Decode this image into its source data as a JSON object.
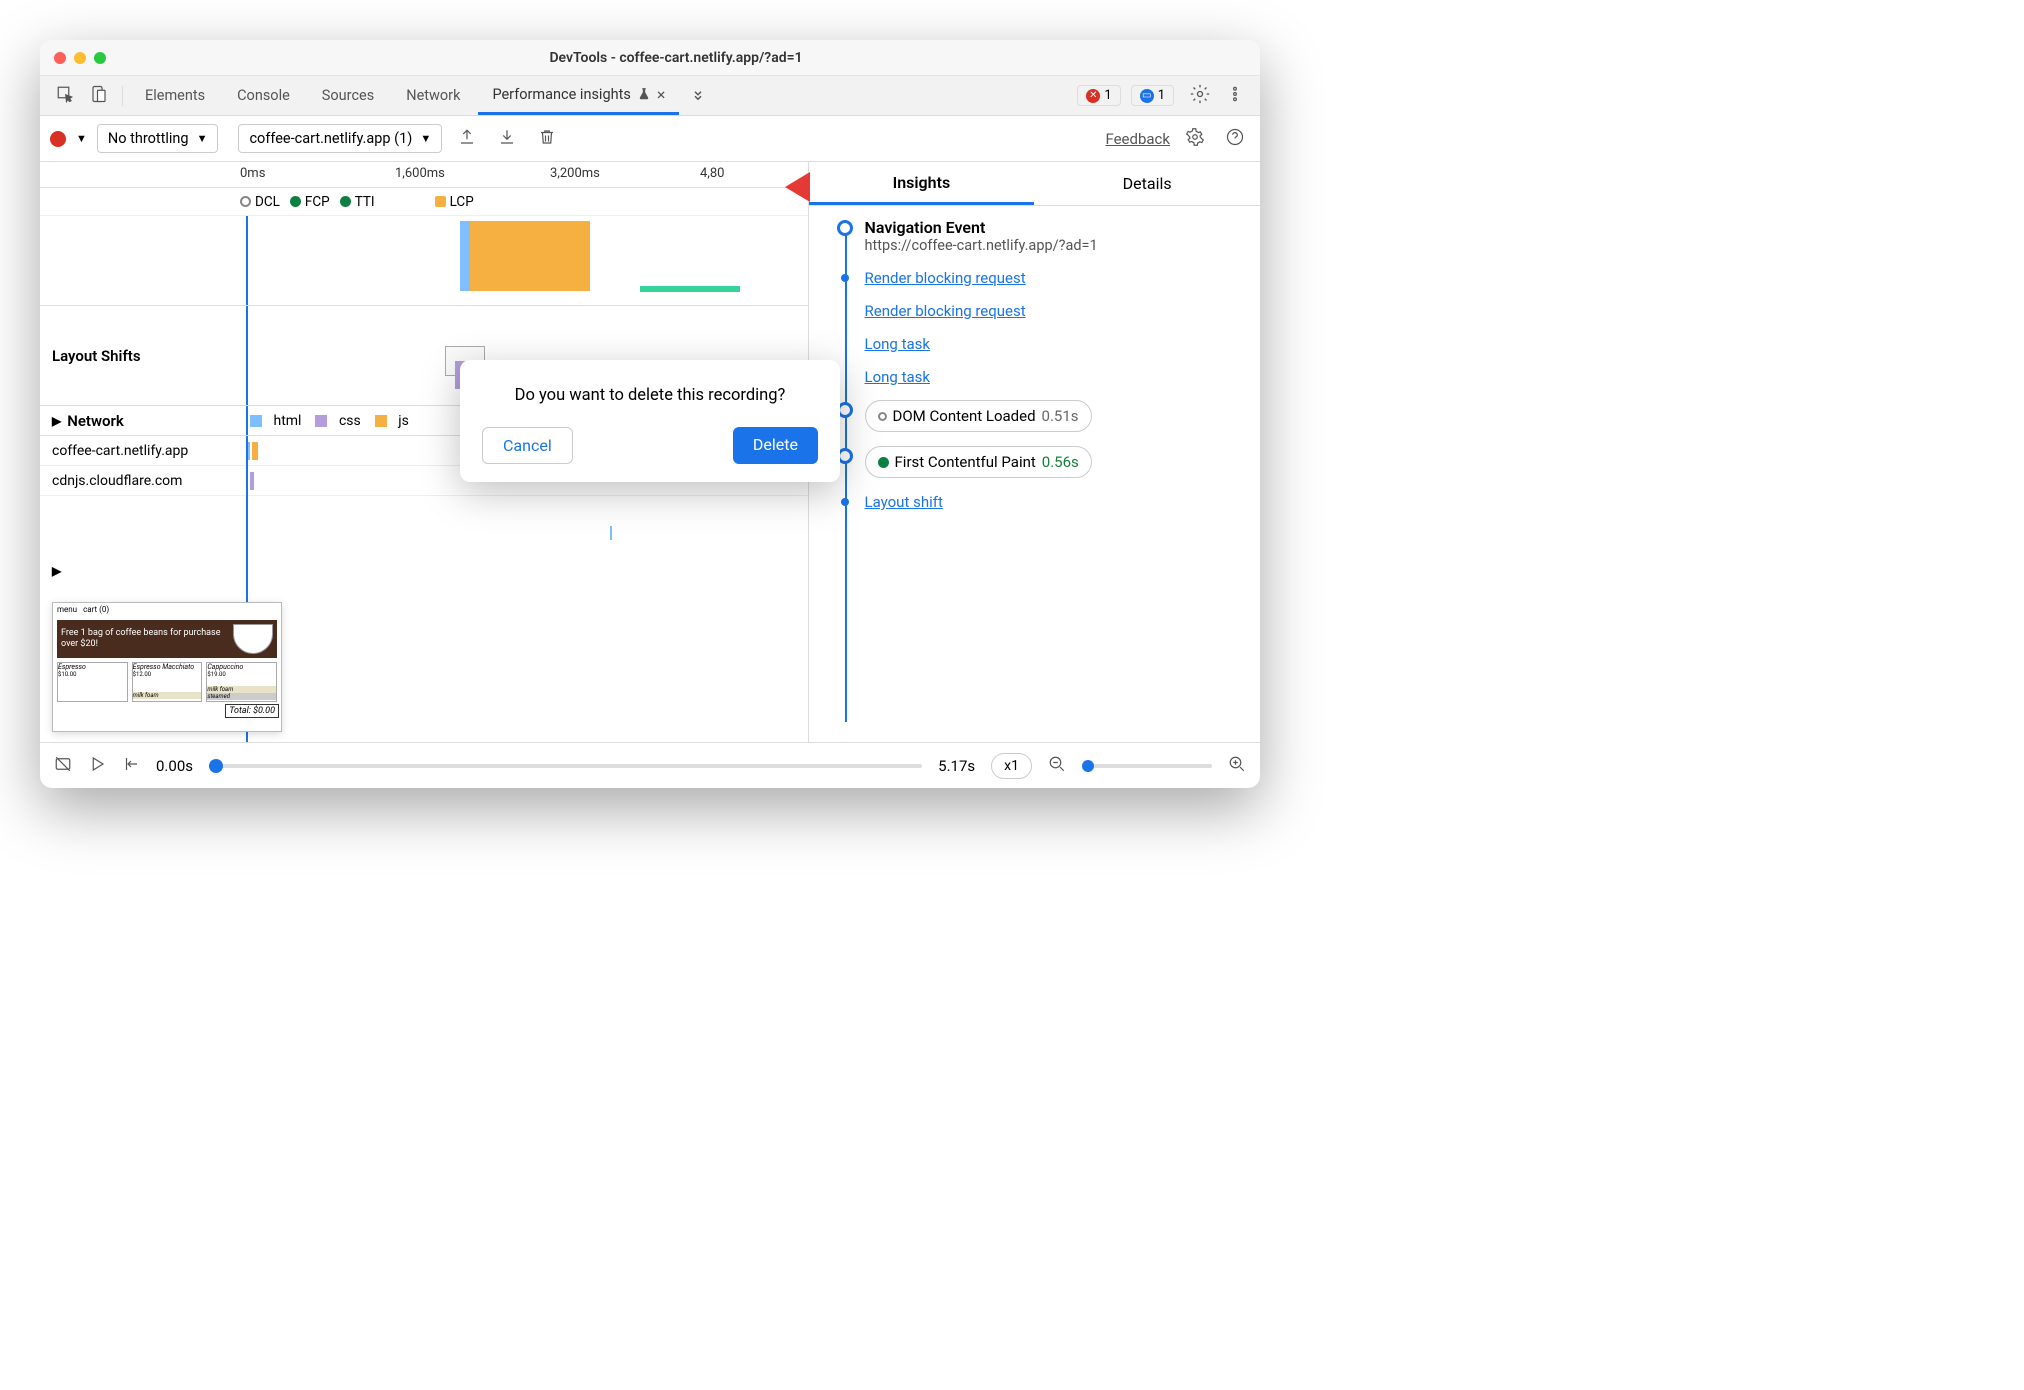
{
  "window": {
    "title": "DevTools - coffee-cart.netlify.app/?ad=1"
  },
  "tabs": {
    "elements": "Elements",
    "console": "Console",
    "sources": "Sources",
    "network": "Network",
    "perf_insights": "Performance insights",
    "errors_count": "1",
    "info_count": "1"
  },
  "toolbar": {
    "throttling": "No throttling",
    "recording": "coffee-cart.netlify.app (1)",
    "feedback": "Feedback"
  },
  "timeline": {
    "ticks": {
      "t0": "0ms",
      "t1": "1,600ms",
      "t2": "3,200ms",
      "t3": "4,80"
    },
    "markers": {
      "dcl": "DCL",
      "fcp": "FCP",
      "tti": "TTI",
      "lcp": "LCP"
    }
  },
  "tracks": {
    "layout_shifts": "Layout Shifts",
    "network": "Network",
    "net_legend": {
      "html": "html",
      "css": "css",
      "js": "js"
    },
    "hosts": {
      "h1": "coffee-cart.netlify.app",
      "h2": "cdnjs.cloudflare.com"
    }
  },
  "thumbnail": {
    "menu": "menu",
    "cart": "cart (0)",
    "banner": "Free 1 bag of coffee beans for purchase over $20!",
    "p1": "Espresso",
    "p1p": "$10.00",
    "p2": "Espresso Macchiato",
    "p2p": "$12.00",
    "p3": "Cappuccino",
    "p3p": "$19.00",
    "mf": "milk foam",
    "st": "steamed",
    "total": "Total: $0.00"
  },
  "right": {
    "insights_tab": "Insights",
    "details_tab": "Details",
    "nav_title": "Navigation Event",
    "nav_url": "https://coffee-cart.netlify.app/?ad=1",
    "rbr": "Render blocking request",
    "long_task": "Long task",
    "dcl_label": "DOM Content Loaded",
    "dcl_time": "0.51s",
    "fcp_label": "First Contentful Paint",
    "fcp_time": "0.56s",
    "layout_shift": "Layout shift"
  },
  "playback": {
    "start": "0.00s",
    "end": "5.17s",
    "speed": "x1"
  },
  "dialog": {
    "message": "Do you want to delete this recording?",
    "cancel": "Cancel",
    "delete": "Delete"
  }
}
